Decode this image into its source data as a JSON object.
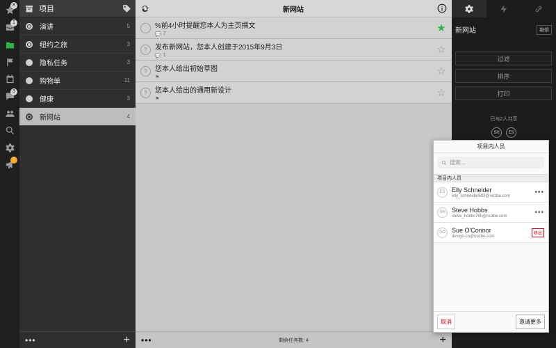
{
  "rail": {
    "items": [
      {
        "icon": "star-icon",
        "badge": "8"
      },
      {
        "icon": "inbox-icon",
        "badge": "1"
      },
      {
        "icon": "projects-icon",
        "badge": ""
      },
      {
        "icon": "flag-icon",
        "badge": ""
      },
      {
        "icon": "calendar-icon",
        "badge": ""
      },
      {
        "icon": "comments-icon",
        "badge": "3"
      },
      {
        "icon": "team-icon",
        "badge": ""
      },
      {
        "icon": "search-icon",
        "badge": ""
      },
      {
        "icon": "gear-icon",
        "badge": ""
      },
      {
        "icon": "megaphone-icon",
        "badge": "!"
      }
    ]
  },
  "projects": {
    "title": "项目",
    "items": [
      {
        "name": "演讲",
        "count": "5"
      },
      {
        "name": "纽约之旅",
        "count": "3"
      },
      {
        "name": "隐私任务",
        "count": "3"
      },
      {
        "name": "购物单",
        "count": "11"
      },
      {
        "name": "健康",
        "count": "3"
      },
      {
        "name": "新网站",
        "count": "4"
      }
    ],
    "footer_more": "•••",
    "footer_add": "+"
  },
  "tasks": {
    "title": "新网站",
    "items": [
      {
        "name": "%前4小时提醒您本人为主页撰文",
        "meta": "7"
      },
      {
        "name": "发布新网站，您本人创建于2015年9月3日",
        "meta": "1"
      },
      {
        "name": "您本人给出初始草图",
        "meta": ""
      },
      {
        "name": "您本人给出的通用新设计",
        "meta": ""
      }
    ],
    "footer_more": "•••",
    "remaining": "剩余任务数: 4",
    "footer_add": "+"
  },
  "right": {
    "project_name": "新网站",
    "edit_label": "编辑",
    "filter_label": "过滤",
    "sort_label": "排序",
    "print_label": "打印",
    "shared_text": "已与2人共享",
    "avatars": [
      "SH",
      "ES"
    ]
  },
  "popover": {
    "title": "项目内人员",
    "search_placeholder": "搜索...",
    "section_label": "项目内人员",
    "members": [
      {
        "initials": "ES",
        "name": "Elly Schneider",
        "email": "elly_schneider693@nozbe.com",
        "action": "•••"
      },
      {
        "initials": "SH",
        "name": "Steve Hobbs",
        "email": "steve_hobbs760@nozbe.com",
        "action": "•••"
      },
      {
        "initials": "SO",
        "name": "Sue O'Connor",
        "email": "design-cn@nozbe.com",
        "action": "移出"
      }
    ],
    "cancel_label": "取消",
    "invite_label": "邀请更多"
  },
  "colors": {
    "accent": "#2db34a",
    "danger": "#d0021b"
  }
}
